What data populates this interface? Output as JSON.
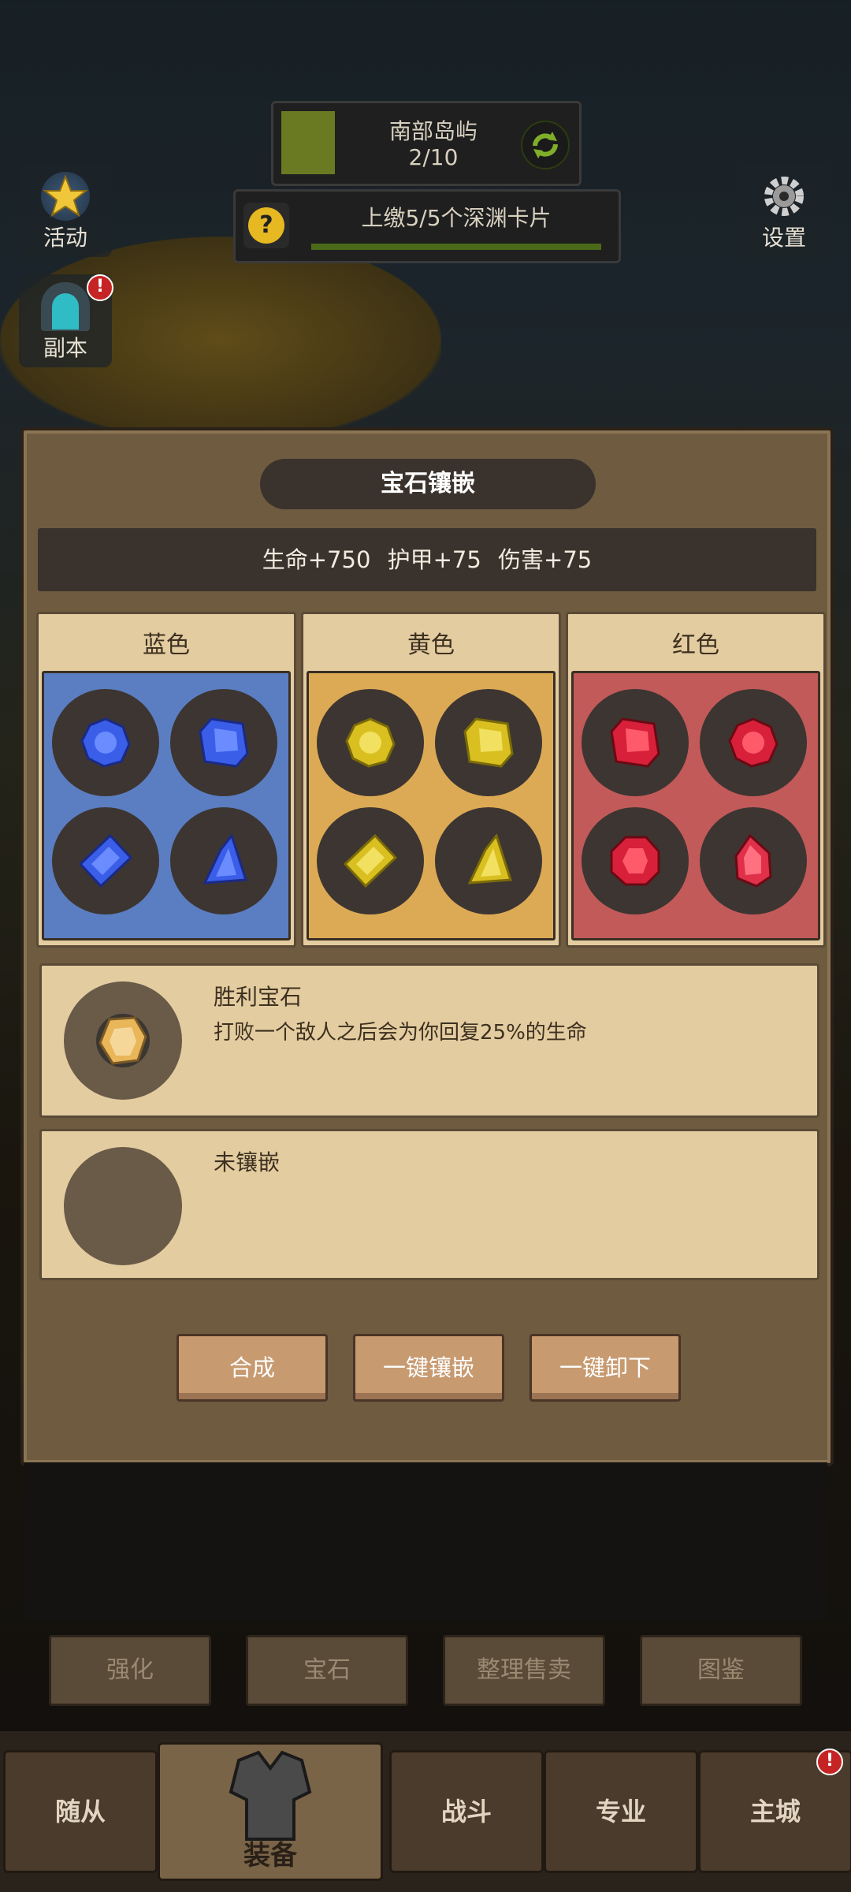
{
  "hud": {
    "location_name": "南部岛屿",
    "location_progress": "2/10",
    "location_fill": 0.2,
    "quest_text": "上缴5/5个深渊卡片",
    "quest_fill": 1.0,
    "quest_icon": "?"
  },
  "left_buttons": [
    {
      "label": "活动",
      "icon": "star-icon"
    },
    {
      "label": "副本",
      "icon": "dungeon-door-icon",
      "badge": "!"
    }
  ],
  "right_buttons": [
    {
      "label": "设置",
      "icon": "gear-icon"
    }
  ],
  "dialog": {
    "title": "宝石镶嵌",
    "stats": "生命+750   护甲+75   伤害+75",
    "columns": [
      {
        "label": "蓝色",
        "color": "#5b7ec2",
        "gem_color": "#3b5ee0"
      },
      {
        "label": "黄色",
        "color": "#dcaa55",
        "gem_color": "#d9c23a"
      },
      {
        "label": "红色",
        "color": "#c25a5a",
        "gem_color": "#d8283a"
      }
    ],
    "socket1": {
      "name": "胜利宝石",
      "desc": "打败一个敌人之后会为你回复25%的生命"
    },
    "socket2": {
      "name": "未镶嵌"
    },
    "buttons": {
      "craft": "合成",
      "embed_all": "一键镶嵌",
      "remove_all": "一键卸下"
    }
  },
  "sub_tabs": [
    "强化",
    "宝石",
    "整理售卖",
    "图鉴"
  ],
  "nav": {
    "follower": "随从",
    "equipment": "装备",
    "battle": "战斗",
    "profession": "专业",
    "city": "主城",
    "city_badge": "!"
  }
}
